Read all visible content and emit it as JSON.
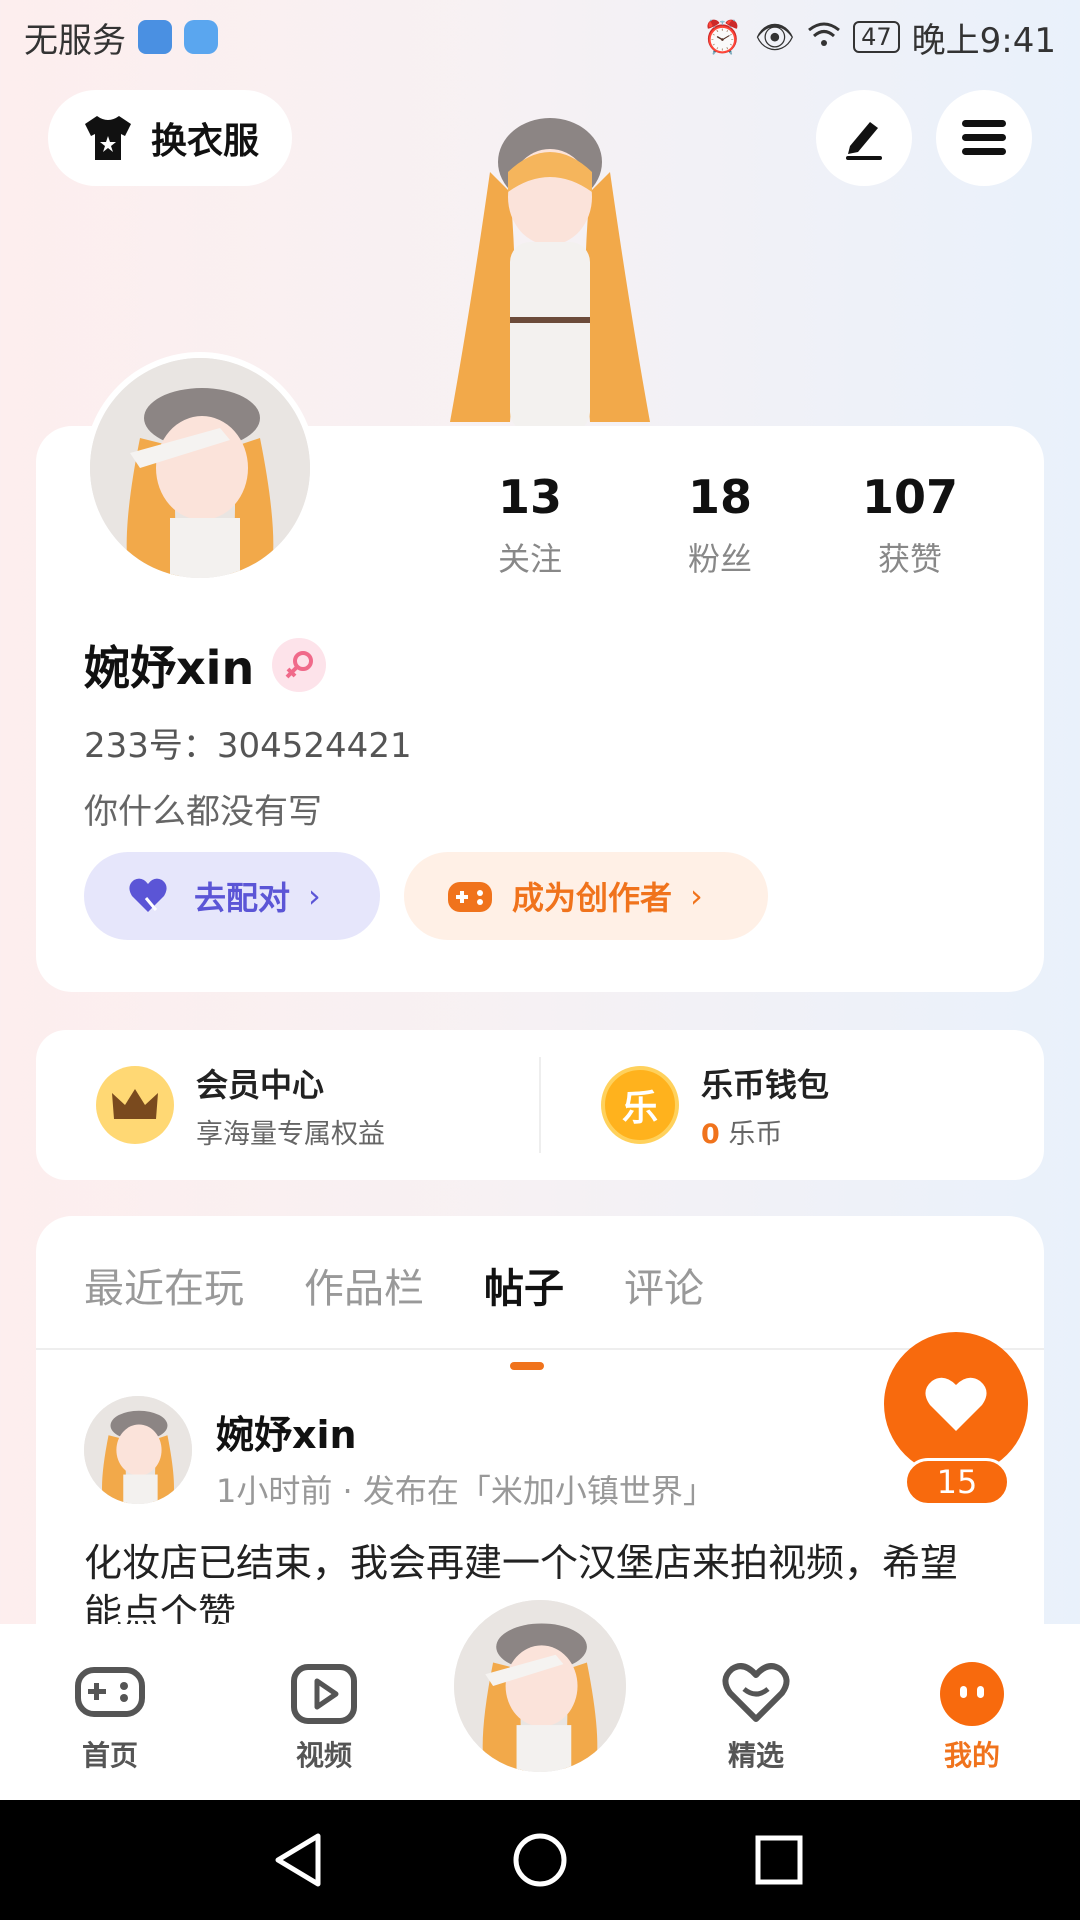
{
  "status_bar": {
    "carrier": "无服务",
    "battery": "47",
    "time": "晚上9:41"
  },
  "top": {
    "outfit_label": "换衣服"
  },
  "profile": {
    "stats": [
      {
        "num": "13",
        "label": "关注"
      },
      {
        "num": "18",
        "label": "粉丝"
      },
      {
        "num": "107",
        "label": "获赞"
      }
    ],
    "name": "婉妤xin",
    "uid": "233号：304524421",
    "bio": "你什么都没有写",
    "match_label": "去配对",
    "creator_label": "成为创作者"
  },
  "wallet": {
    "vip_title": "会员中心",
    "vip_sub": "享海量专属权益",
    "coin_title": "乐币钱包",
    "coin_amount": "0",
    "coin_unit": "乐币",
    "coin_badge": "乐"
  },
  "tabs": [
    "最近在玩",
    "作品栏",
    "帖子",
    "评论"
  ],
  "post": {
    "author": "婉妤xin",
    "meta": "1小时前 · 发布在「米加小镇世界」",
    "text": "化妆店已结束，我会再建一个汉堡店来拍视频，希望能点个赞",
    "likes": "15"
  },
  "nav": {
    "home": "首页",
    "video": "视频",
    "pick": "精选",
    "mine": "我的"
  },
  "colors": {
    "accent": "#f0731c",
    "match": "#5b55d6"
  }
}
